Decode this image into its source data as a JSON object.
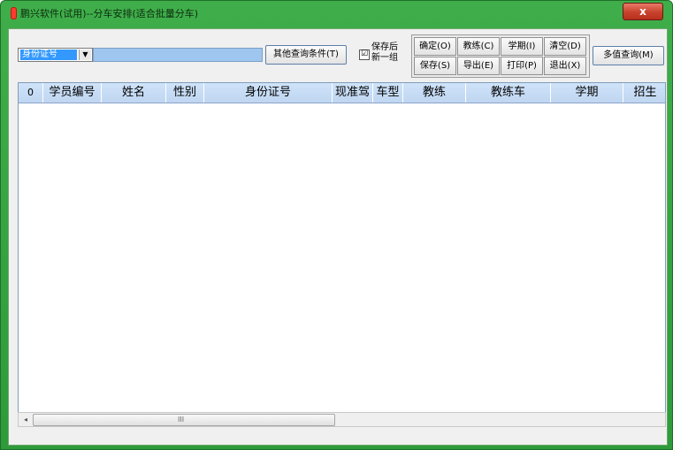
{
  "window": {
    "title": "鹏兴软件(试用)--分车安排(适合批量分车)",
    "close_label": "x"
  },
  "query": {
    "field_select_value": "身份证号",
    "text_value": "",
    "other_conditions_button": "其他查询条件(T)",
    "save_new_group_checked": "☑",
    "save_new_group_label_line1": "保存后",
    "save_new_group_label_line2": "新一组",
    "multi_value_query_button": "多值查询(M)"
  },
  "actions": {
    "confirm": "确定(O)",
    "coach": "教练(C)",
    "term": "学期(I)",
    "clear": "清空(D)",
    "save": "保存(S)",
    "export": "导出(E)",
    "print": "打印(P)",
    "exit": "退出(X)"
  },
  "table": {
    "columns": [
      "0",
      "学员编号",
      "姓名",
      "性别",
      "身份证号",
      "现准驾",
      "车型",
      "教练",
      "教练车",
      "学期",
      "招生"
    ],
    "rows": []
  },
  "scrollbar": {
    "left_arrow": "◂",
    "grip": "III"
  },
  "colors": {
    "window_frame": "#3fae4a",
    "close_button": "#c8412d",
    "header_bg": "#cfe3f9",
    "selection": "#3399ff",
    "input_bg": "#9fc6ef"
  }
}
